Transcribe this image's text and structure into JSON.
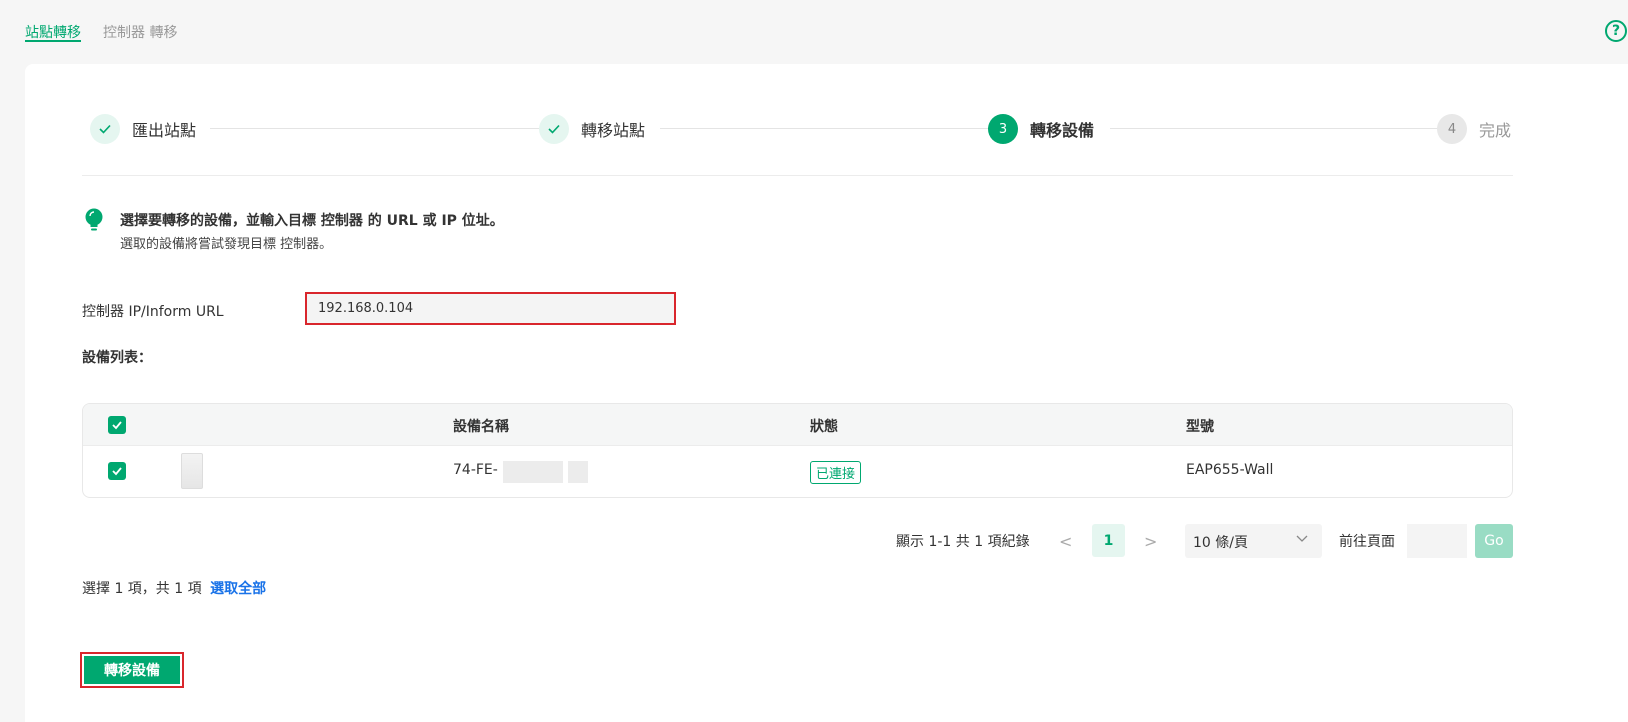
{
  "top_tabs": [
    {
      "label": "站點轉移",
      "active": true
    },
    {
      "label": "控制器 轉移",
      "active": false
    }
  ],
  "help_icon": "?",
  "stepper": {
    "steps": [
      {
        "label": "匯出站點",
        "state": "done"
      },
      {
        "label": "轉移站點",
        "state": "done"
      },
      {
        "number": "3",
        "label": "轉移設備",
        "state": "current"
      },
      {
        "number": "4",
        "label": "完成",
        "state": "pending"
      }
    ]
  },
  "tip": {
    "title": "選擇要轉移的設備，並輸入目標 控制器 的 URL 或 IP 位址。",
    "subtitle": "選取的設備將嘗試發現目標 控制器。"
  },
  "controller_field": {
    "label": "控制器 IP/Inform URL",
    "value": "192.168.0.104"
  },
  "device_list_label": "設備列表：",
  "table": {
    "columns": [
      "設備名稱",
      "狀態",
      "型號"
    ],
    "rows": [
      {
        "name": "74-FE-",
        "status": "已連接",
        "model": "EAP655-Wall",
        "checked": true
      }
    ]
  },
  "pagination": {
    "info": "顯示 1-1 共 1 項紀錄",
    "prev": "<",
    "current_page": "1",
    "next": ">",
    "page_size": "10 條/頁",
    "goto_label": "前往頁面",
    "go_label": "Go"
  },
  "selection": {
    "info": "選擇 1 項，共 1 項",
    "select_all": "選取全部"
  },
  "migrate_button": "轉移設備",
  "colors": {
    "accent": "#00a870",
    "highlight": "#d9262c",
    "link": "#1a73e8"
  }
}
